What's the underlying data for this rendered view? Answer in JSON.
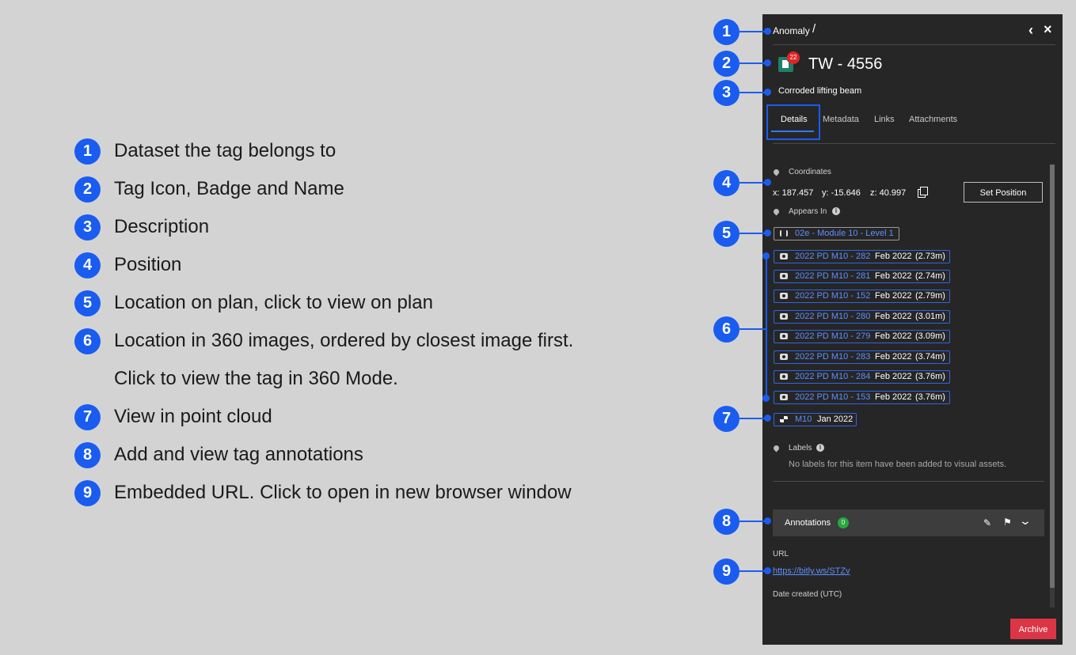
{
  "legend": [
    {
      "num": "1",
      "text": "Dataset the tag belongs to"
    },
    {
      "num": "2",
      "text": "Tag Icon, Badge and Name"
    },
    {
      "num": "3",
      "text": "Description"
    },
    {
      "num": "4",
      "text": "Position"
    },
    {
      "num": "5",
      "text": "Location on plan, click to view on plan"
    },
    {
      "num": "6",
      "text": "Location in 360 images, ordered by closest image first.",
      "text2": "Click to view the tag in 360 Mode."
    },
    {
      "num": "7",
      "text": "View in point cloud"
    },
    {
      "num": "8",
      "text": "Add and view tag annotations"
    },
    {
      "num": "9",
      "text": "Embedded URL. Click to open in new browser window"
    }
  ],
  "panel": {
    "breadcrumb": "Anomaly",
    "breadcrumb_sep": "/",
    "back_glyph": "‹",
    "close_glyph": "×",
    "tag": {
      "badge": "22",
      "name": "TW - 4556",
      "description": "Corroded lifting beam"
    },
    "tabs": [
      "Details",
      "Metadata",
      "Links",
      "Attachments"
    ],
    "coordinates": {
      "label": "Coordinates",
      "x": "x: 187.457",
      "y": "y: -15.646",
      "z": "z: 40.997",
      "set_position": "Set Position"
    },
    "appears_in": {
      "label": "Appears In",
      "info": "i",
      "plan": "02e - Module 10 - Level 1",
      "images": [
        {
          "name": "2022 PD M10 - 282",
          "date": "Feb 2022",
          "dist": "(2.73m)"
        },
        {
          "name": "2022 PD M10 - 281",
          "date": "Feb 2022",
          "dist": "(2.74m)"
        },
        {
          "name": "2022 PD M10 - 152",
          "date": "Feb 2022",
          "dist": "(2.79m)"
        },
        {
          "name": "2022 PD M10 - 280",
          "date": "Feb 2022",
          "dist": "(3.01m)"
        },
        {
          "name": "2022 PD M10 - 279",
          "date": "Feb 2022",
          "dist": "(3.09m)"
        },
        {
          "name": "2022 PD M10 - 283",
          "date": "Feb 2022",
          "dist": "(3.74m)"
        },
        {
          "name": "2022 PD M10 - 284",
          "date": "Feb 2022",
          "dist": "(3.76m)"
        },
        {
          "name": "2022 PD M10 - 153",
          "date": "Feb 2022",
          "dist": "(3.76m)"
        }
      ],
      "pointcloud": {
        "name": "M10",
        "date": "Jan 2022"
      }
    },
    "labels": {
      "label": "Labels",
      "info": "i",
      "empty": "No labels for this item have been added to visual assets."
    },
    "annotations": {
      "label": "Annotations",
      "count": "0"
    },
    "url": {
      "label": "URL",
      "value": "https://bitly.ws/STZv"
    },
    "date_created": {
      "label": "Date created (UTC)"
    },
    "archive": "Archive"
  },
  "callouts": [
    "1",
    "2",
    "3",
    "4",
    "5",
    "6",
    "7",
    "8",
    "9"
  ],
  "colors": {
    "accent": "#1a5cf0",
    "link": "#5f8fff",
    "archive": "#dc3545",
    "panel": "#262626",
    "badge": "#e02525",
    "count": "#27a83e"
  }
}
